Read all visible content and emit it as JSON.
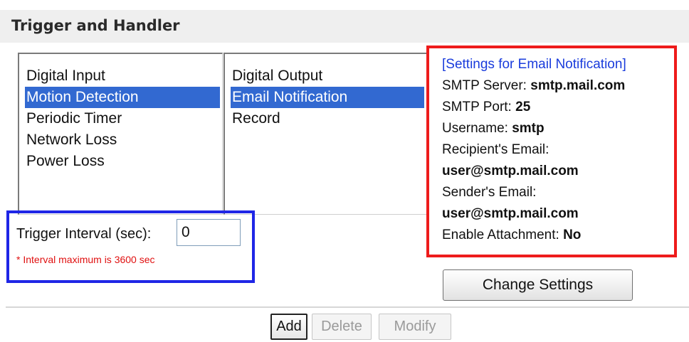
{
  "header": {
    "title": "Trigger and Handler"
  },
  "trigger_list": {
    "items": [
      {
        "label": "Digital Input",
        "selected": false
      },
      {
        "label": "Motion Detection",
        "selected": true
      },
      {
        "label": "Periodic Timer",
        "selected": false
      },
      {
        "label": "Network Loss",
        "selected": false
      },
      {
        "label": "Power Loss",
        "selected": false
      }
    ]
  },
  "handler_list": {
    "items": [
      {
        "label": "Digital Output",
        "selected": false
      },
      {
        "label": "Email Notification",
        "selected": true
      },
      {
        "label": "Record",
        "selected": false
      }
    ]
  },
  "interval": {
    "label": "Trigger Interval (sec):",
    "value": "0",
    "note": "* Interval maximum is 3600 sec"
  },
  "settings": {
    "title": "[Settings for Email Notification]",
    "smtp_server_label": "SMTP Server:",
    "smtp_server_value": "smtp.mail.com",
    "smtp_port_label": "SMTP Port:",
    "smtp_port_value": "25",
    "username_label": "Username:",
    "username_value": "smtp",
    "recipient_label": "Recipient's Email:",
    "recipient_value": "user@smtp.mail.com",
    "sender_label": "Sender's Email:",
    "sender_value": "user@smtp.mail.com",
    "attachment_label": "Enable Attachment:",
    "attachment_value": "No",
    "change_button": "Change Settings"
  },
  "actions": {
    "add": "Add",
    "delete": "Delete",
    "modify": "Modify"
  },
  "colors": {
    "selection": "#3269d1",
    "settings_border": "#ee1b1b",
    "interval_border": "#1f26e6",
    "note_text": "#e01010",
    "settings_title": "#1a3cdc"
  }
}
